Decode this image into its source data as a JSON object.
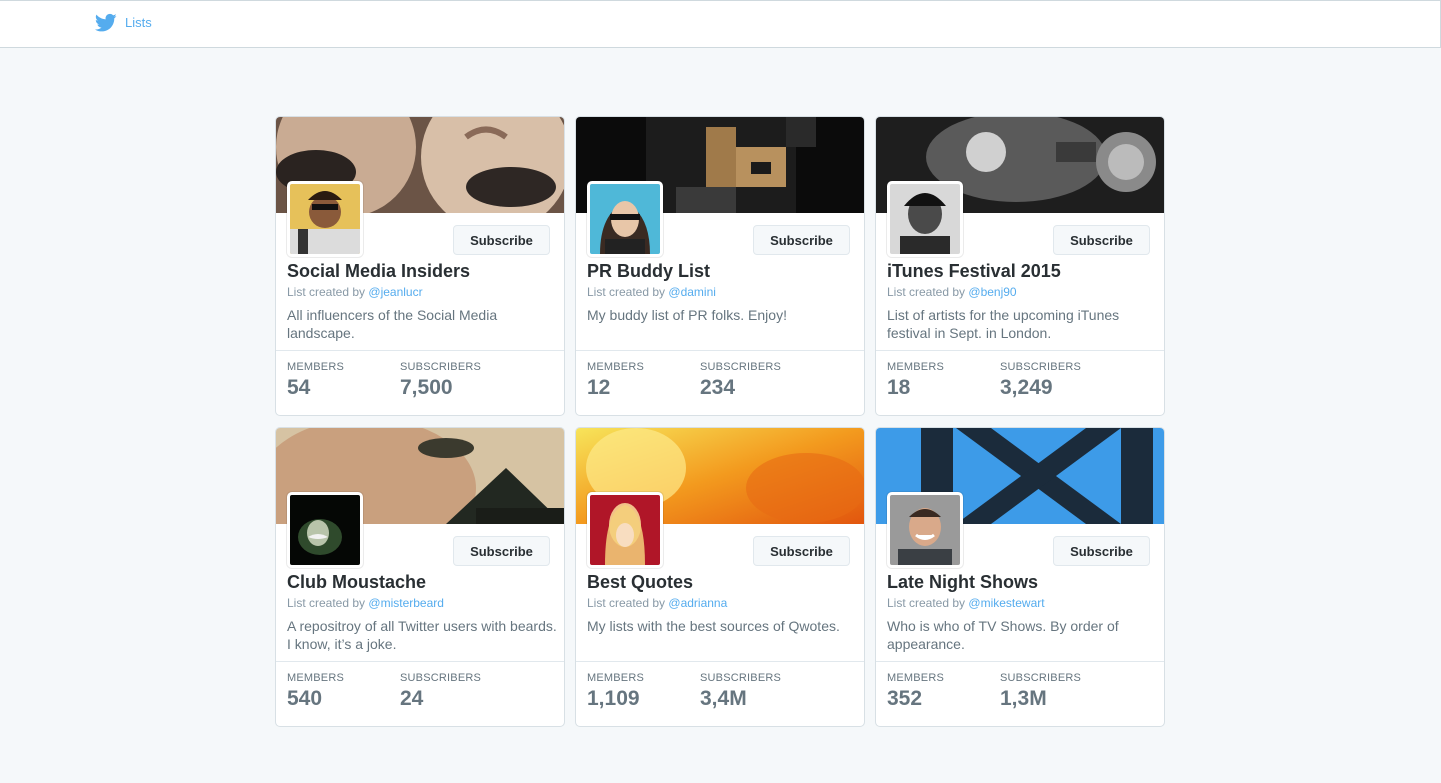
{
  "header": {
    "title": "Lists",
    "brand_icon": "twitter-bird-icon",
    "accent": "#55acee"
  },
  "stat_labels": {
    "members": "MEMBERS",
    "subscribers": "SUBSCRIBERS"
  },
  "created_prefix": "List created by",
  "lists": [
    {
      "name": "Social Media Insiders",
      "creator": "@jeanlucr",
      "description": "All influencers of the Social Media landscape.",
      "members": "54",
      "subscribers": "7,500",
      "subscribe_label": "Subscribe",
      "banner_color": "#8a6a58",
      "avatar_color": "#cfa54a"
    },
    {
      "name": "PR Buddy List",
      "creator": "@damini",
      "description": "My buddy list of PR folks. Enjoy!",
      "members": "12",
      "subscribers": "234",
      "subscribe_label": "Subscribe",
      "banner_color": "#1a1a1a",
      "avatar_color": "#4fb8d8"
    },
    {
      "name": "iTunes Festival 2015",
      "creator": "@benj90",
      "description": "List of artists for the upcoming iTunes festival in Sept. in London.",
      "members": "18",
      "subscribers": "3,249",
      "subscribe_label": "Subscribe",
      "banner_color": "#3a3a3a",
      "avatar_color": "#8a8a8a"
    },
    {
      "name": "Club Moustache",
      "creator": "@misterbeard",
      "description": "A repositroy of all Twitter users with beards. I know, it’s a joke.",
      "members": "540",
      "subscribers": "24",
      "subscribe_label": "Subscribe",
      "banner_color": "#b89a78",
      "avatar_color": "#0c0f0c"
    },
    {
      "name": "Best Quotes",
      "creator": "@adrianna",
      "description": "My lists with the best sources of Qwotes.",
      "members": "1,109",
      "subscribers": "3,4M",
      "subscribe_label": "Subscribe",
      "banner_color": "#f28a1a",
      "avatar_color": "#c0283a"
    },
    {
      "name": "Late Night Shows",
      "creator": "@mikestewart",
      "description": "Who is who of TV Shows. By order of appearance.",
      "members": "352",
      "subscribers": "1,3M",
      "subscribe_label": "Subscribe",
      "banner_color": "#3a9ae8",
      "avatar_color": "#8c8c8c"
    }
  ]
}
